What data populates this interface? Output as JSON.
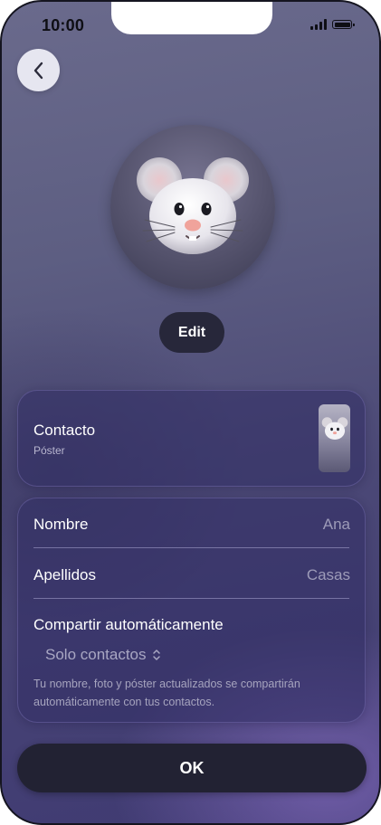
{
  "status_bar": {
    "time": "10:00"
  },
  "profile": {
    "avatar_icon": "mouse-memoji",
    "edit_label": "Edit"
  },
  "contact_card": {
    "title": "Contacto",
    "subtitle": "Póster"
  },
  "form": {
    "first_name_label": "Nombre",
    "first_name_value": "Ana",
    "last_name_label": "Apellidos",
    "last_name_value": "Casas",
    "share_label": "Compartir automáticamente",
    "share_value": "Solo contactos",
    "share_note": "Tu nombre, foto y póster actualizados se compartirán automáticamente con tus contactos."
  },
  "ok_label": "OK",
  "colors": {
    "background_top": "#6a6a8c",
    "background_bottom": "#3f3a72",
    "button_dark": "#222233"
  }
}
